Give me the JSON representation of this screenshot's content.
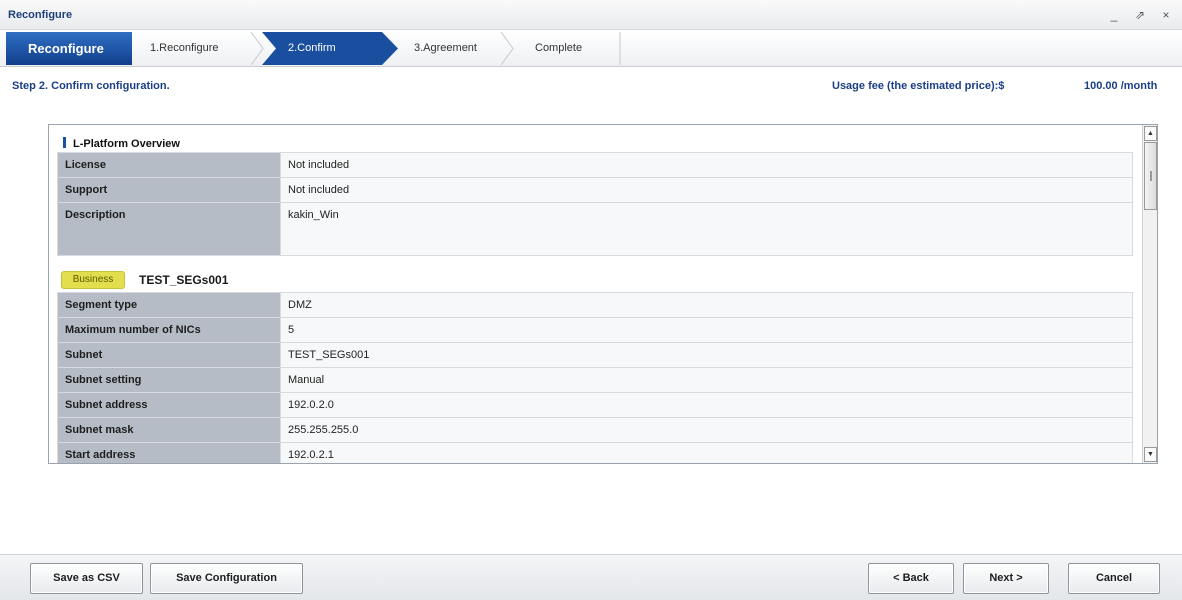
{
  "window": {
    "title": "Reconfigure",
    "controls": [
      "_",
      "⇗",
      "×"
    ]
  },
  "wizard": {
    "main_label": "Reconfigure",
    "steps": [
      {
        "label": "1.Reconfigure",
        "active": false
      },
      {
        "label": "2.Confirm",
        "active": true
      },
      {
        "label": "3.Agreement",
        "active": false
      },
      {
        "label": "Complete",
        "active": false
      }
    ],
    "active_color": "#1a4f9f"
  },
  "header": {
    "step_title": "Step 2. Confirm configuration.",
    "fee_label": "Usage fee (the estimated price):$",
    "fee_value": "100.00 /month"
  },
  "overview": {
    "title": "L-Platform Overview",
    "rows": [
      {
        "label": "License",
        "value": "Not included"
      },
      {
        "label": "Support",
        "value": "Not included"
      },
      {
        "label": "Description",
        "value": "kakin_Win"
      }
    ]
  },
  "business": {
    "badge": "Business",
    "name": "TEST_SEGs001",
    "rows": [
      {
        "label": "Segment type",
        "value": "DMZ"
      },
      {
        "label": "Maximum number of NICs",
        "value": "5"
      },
      {
        "label": "Subnet",
        "value": "TEST_SEGs001"
      },
      {
        "label": "Subnet setting",
        "value": "Manual"
      },
      {
        "label": "Subnet address",
        "value": "192.0.2.0"
      },
      {
        "label": "Subnet mask",
        "value": "255.255.255.0"
      },
      {
        "label": "Start address",
        "value": "192.0.2.1"
      }
    ]
  },
  "scrollbar": {
    "up": "▲",
    "down": "▼"
  },
  "footer": {
    "save_csv": "Save as CSV",
    "save_config": "Save Configuration",
    "back": "< Back",
    "next": "Next >",
    "cancel": "Cancel"
  }
}
